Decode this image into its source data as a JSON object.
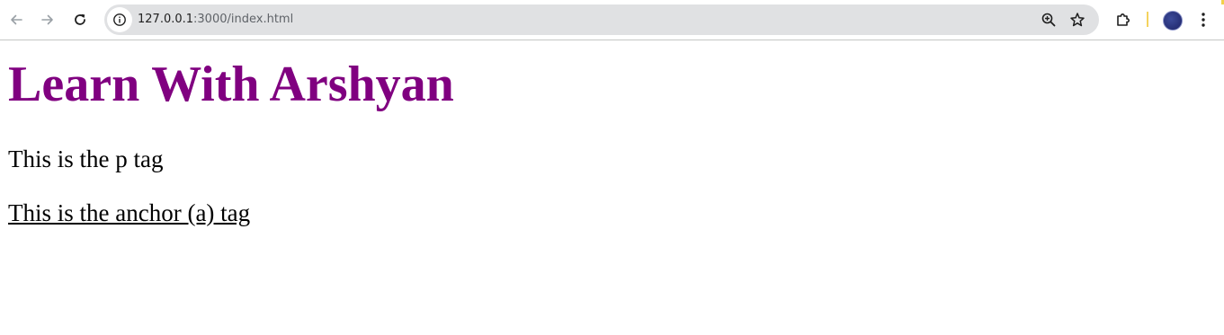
{
  "browser": {
    "url_host": "127.0.0.1",
    "url_rest": ":3000/index.html",
    "icons": {
      "back": "arrow-left-icon",
      "forward": "arrow-right-icon",
      "reload": "reload-icon",
      "site_info": "info-icon",
      "zoom": "zoom-in-icon",
      "bookmark": "star-icon",
      "extensions": "puzzle-icon",
      "profile": "avatar",
      "menu": "kebab-menu-icon"
    }
  },
  "page": {
    "heading": "Learn With Arshyan",
    "paragraph": "This is the p tag",
    "anchor": "This is the anchor (a) tag"
  },
  "colors": {
    "heading": "#800080",
    "text": "#000000",
    "omnibox": "#e0e1e3"
  }
}
